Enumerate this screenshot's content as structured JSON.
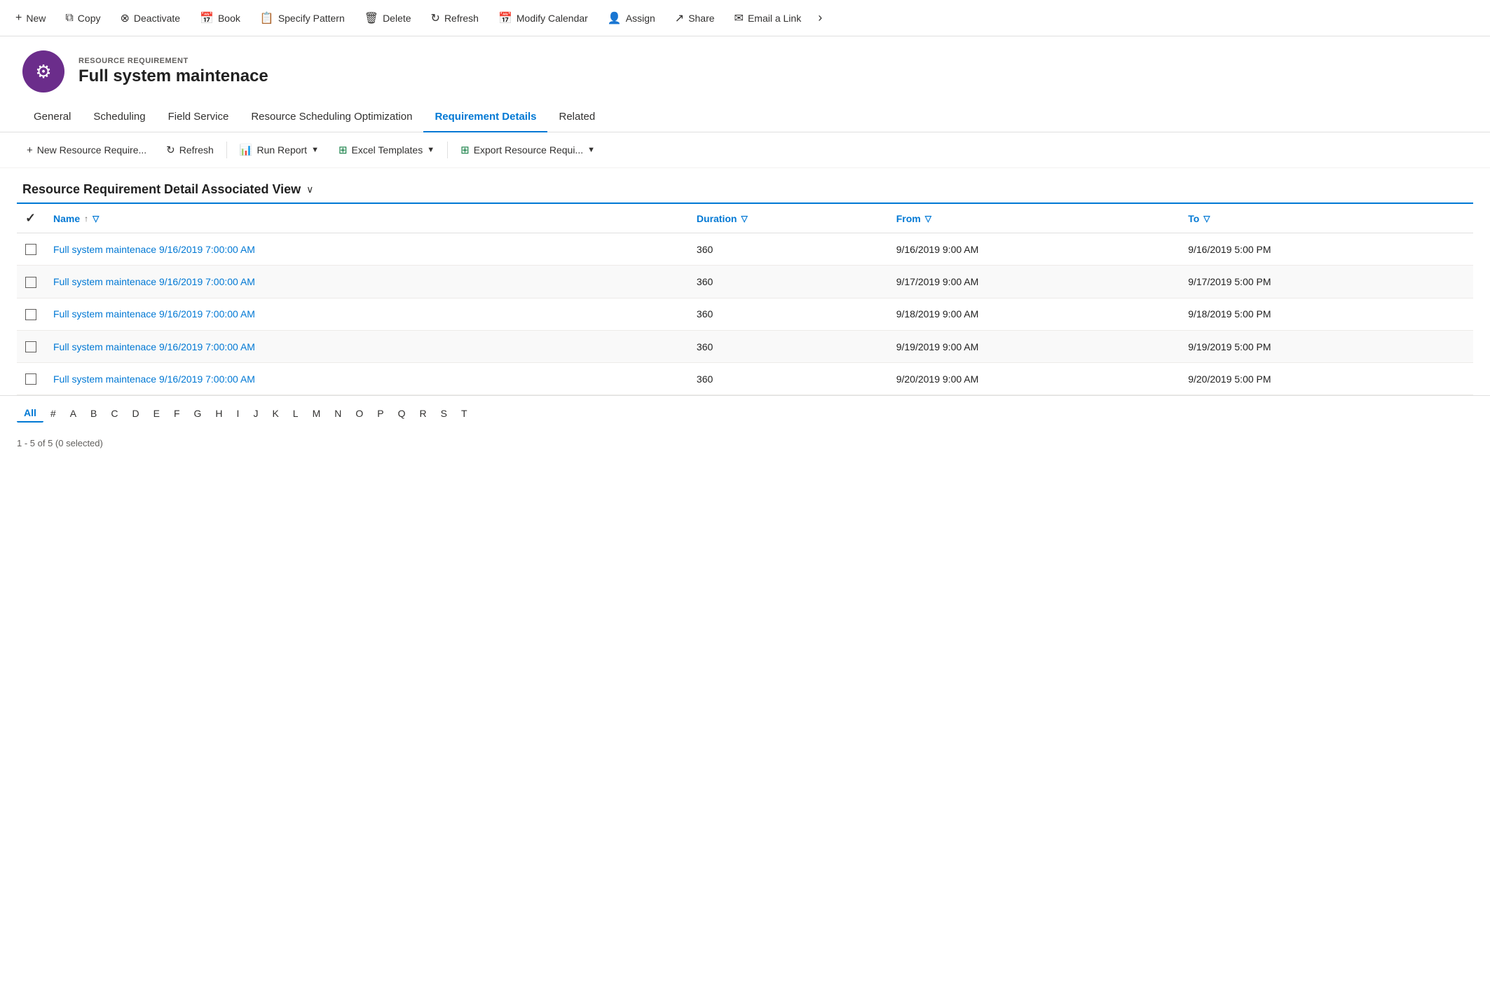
{
  "toolbar": {
    "buttons": [
      {
        "id": "new",
        "label": "New",
        "icon": "+"
      },
      {
        "id": "copy",
        "label": "Copy",
        "icon": "⧉"
      },
      {
        "id": "deactivate",
        "label": "Deactivate",
        "icon": "⊗"
      },
      {
        "id": "book",
        "label": "Book",
        "icon": "📅"
      },
      {
        "id": "specify-pattern",
        "label": "Specify Pattern",
        "icon": "📋"
      },
      {
        "id": "delete",
        "label": "Delete",
        "icon": "🗑"
      },
      {
        "id": "refresh",
        "label": "Refresh",
        "icon": "↻"
      },
      {
        "id": "modify-calendar",
        "label": "Modify Calendar",
        "icon": "📅"
      },
      {
        "id": "assign",
        "label": "Assign",
        "icon": "👤"
      },
      {
        "id": "share",
        "label": "Share",
        "icon": "↗"
      },
      {
        "id": "email-link",
        "label": "Email a Link",
        "icon": "✉"
      }
    ]
  },
  "record": {
    "type": "RESOURCE REQUIREMENT",
    "title": "Full system maintenace",
    "avatar_icon": "⚙"
  },
  "tabs": [
    {
      "id": "general",
      "label": "General",
      "active": false
    },
    {
      "id": "scheduling",
      "label": "Scheduling",
      "active": false
    },
    {
      "id": "field-service",
      "label": "Field Service",
      "active": false
    },
    {
      "id": "resource-scheduling",
      "label": "Resource Scheduling Optimization",
      "active": false
    },
    {
      "id": "requirement-details",
      "label": "Requirement Details",
      "active": true
    },
    {
      "id": "related",
      "label": "Related",
      "active": false
    }
  ],
  "sub_toolbar": {
    "buttons": [
      {
        "id": "new-resource",
        "label": "New Resource Require...",
        "icon": "+"
      },
      {
        "id": "refresh",
        "label": "Refresh",
        "icon": "↻"
      },
      {
        "id": "run-report",
        "label": "Run Report",
        "icon": "📊",
        "dropdown": true
      },
      {
        "id": "excel-templates",
        "label": "Excel Templates",
        "icon": "⊞",
        "dropdown": true
      },
      {
        "id": "export-resource",
        "label": "Export Resource Requi...",
        "icon": "⊞",
        "dropdown": true
      }
    ]
  },
  "view": {
    "title": "Resource Requirement Detail Associated View",
    "has_dropdown": true
  },
  "table": {
    "columns": [
      {
        "id": "name",
        "label": "Name",
        "sortable": true,
        "filterable": true
      },
      {
        "id": "duration",
        "label": "Duration",
        "filterable": true
      },
      {
        "id": "from",
        "label": "From",
        "filterable": true
      },
      {
        "id": "to",
        "label": "To",
        "filterable": true
      }
    ],
    "rows": [
      {
        "name": "Full system maintenace 9/16/2019 7:00:00 AM",
        "duration": "360",
        "from": "9/16/2019 9:00 AM",
        "to": "9/16/2019 5:00 PM"
      },
      {
        "name": "Full system maintenace 9/16/2019 7:00:00 AM",
        "duration": "360",
        "from": "9/17/2019 9:00 AM",
        "to": "9/17/2019 5:00 PM"
      },
      {
        "name": "Full system maintenace 9/16/2019 7:00:00 AM",
        "duration": "360",
        "from": "9/18/2019 9:00 AM",
        "to": "9/18/2019 5:00 PM"
      },
      {
        "name": "Full system maintenace 9/16/2019 7:00:00 AM",
        "duration": "360",
        "from": "9/19/2019 9:00 AM",
        "to": "9/19/2019 5:00 PM"
      },
      {
        "name": "Full system maintenace 9/16/2019 7:00:00 AM",
        "duration": "360",
        "from": "9/20/2019 9:00 AM",
        "to": "9/20/2019 5:00 PM"
      }
    ]
  },
  "pagination": {
    "letters": [
      "All",
      "#",
      "A",
      "B",
      "C",
      "D",
      "E",
      "F",
      "G",
      "H",
      "I",
      "J",
      "K",
      "L",
      "M",
      "N",
      "O",
      "P",
      "Q",
      "R",
      "S",
      "T"
    ],
    "active": "All"
  },
  "record_count": "1 - 5 of 5 (0 selected)"
}
